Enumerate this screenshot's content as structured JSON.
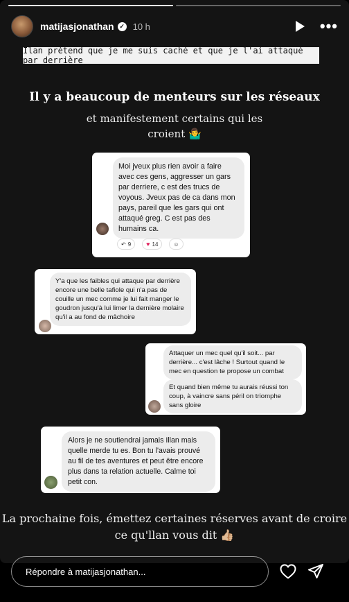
{
  "header": {
    "username": "matijasjonathan",
    "time": "10 h",
    "verified_mark": "✓"
  },
  "banner": "Ilan prétend que je me suis caché et que je l'ai attaqué par derrière",
  "headline": "Il y a beaucoup de menteurs sur les réseaux",
  "subline": "et manifestement certains qui les croient 🤷‍♂️",
  "comments": [
    {
      "text": "Moi jveux plus rien avoir a faire avec ces gens, aggresser un gars par derriere, c est des trucs de voyous. Jveux pas de ca dans mon pays, pareil que les gars qui ont attaqué greg. C est pas des humains ca.",
      "reactions": {
        "replies": "9",
        "likes": "14"
      }
    },
    {
      "text": "Y'a que les faibles qui attaque par derrière encore une belle tafiole qui n'a pas de couille un mec comme je lui fait manger le goudron jusqu'à lui limer la dernière molaire qu'il a au fond de mâchoire"
    },
    {
      "text1": "Attaquer un mec quel qu'il soit... par derrière... c'est lâche ! Surtout quand le mec en question te propose un combat",
      "text2": "Et quand bien même tu aurais réussi ton coup, à vaincre sans péril on triomphe sans gloire"
    },
    {
      "text": "Alors je ne soutiendrai jamais Illan mais quelle merde tu es. Bon tu l'avais prouvé au fil de tes aventures et peut être encore plus dans ta relation actuelle. Calme toi petit con."
    }
  ],
  "footer_text": "La prochaine fois, émettez certaines réserves avant de croire ce qu'llan vous dit 👍🏼",
  "reply": {
    "placeholder": "Répondre à matijasjonathan..."
  },
  "icons": {
    "reply_glyph": "↶",
    "heart_glyph": "♥",
    "emoji_glyph": "☺"
  }
}
